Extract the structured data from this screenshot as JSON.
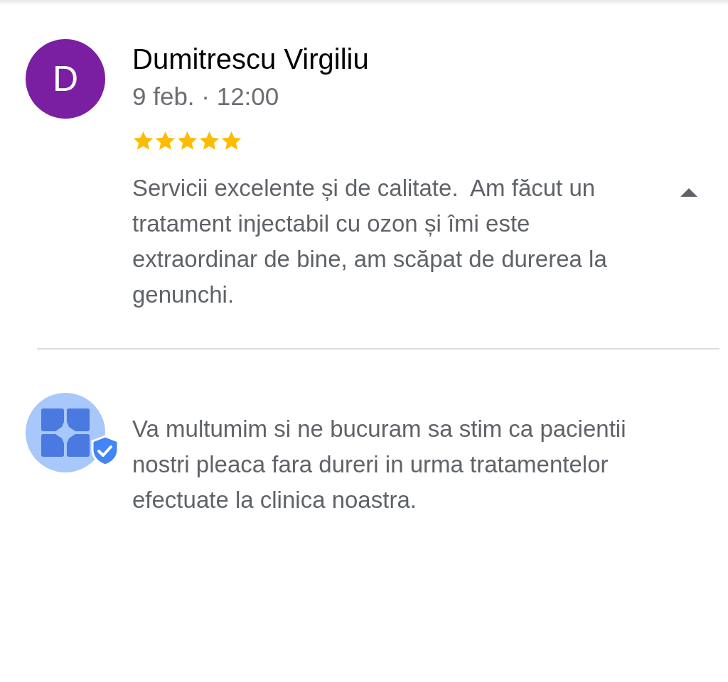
{
  "review": {
    "avatar_letter": "D",
    "author": "Dumitrescu Virgiliu",
    "date": "9 feb. · 12:00",
    "stars": 5,
    "text": "Servicii excelente și de calitate.  Am făcut un tratament injectabil cu ozon și îmi este extraordinar de bine, am scăpat de durerea la genunchi.",
    "expanded": true
  },
  "owner_reply": {
    "text": "Va multumim si ne bucuram sa stim ca pacientii nostri pleaca fara dureri in urma tratamentelor efectuate la clinica noastra."
  }
}
